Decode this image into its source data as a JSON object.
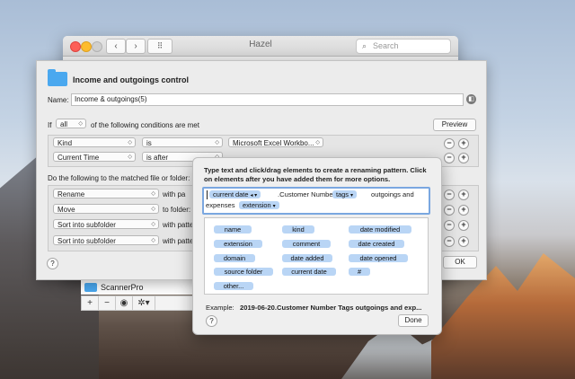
{
  "hazel": {
    "title": "Hazel",
    "search_placeholder": "Search",
    "back_glyph": "‹",
    "forward_glyph": "›",
    "grid_glyph": "⠿",
    "scanner_item": "ScannerPro",
    "bottom_buttons": [
      "+",
      "−",
      "◉",
      "✲▾"
    ]
  },
  "sheet": {
    "title": "Income and outgoings control",
    "name_label": "Name:",
    "name_value": "Income & outgoings(5)",
    "if_label": "If",
    "if_selector": "all",
    "if_rest": "of the following conditions are met",
    "preview_label": "Preview",
    "conditions": [
      {
        "attr": "Kind",
        "op": "is",
        "value": "Microsoft Excel Workbo..."
      },
      {
        "attr": "Current Time",
        "op": "is after",
        "value": ""
      }
    ],
    "do_label": "Do the following to the matched file or folder:",
    "actions": [
      {
        "action": "Rename",
        "with": "with pa"
      },
      {
        "action": "Move",
        "with": "to folder:"
      },
      {
        "action": "Sort into subfolder",
        "with": "with patte"
      },
      {
        "action": "Sort into subfolder",
        "with": "with patte"
      }
    ],
    "help": "?",
    "ok_label": "OK"
  },
  "popover": {
    "instructions": "Type text and click/drag elements to create a renaming pattern. Click on elements after you have added them for more options.",
    "pattern": {
      "token1": "current date",
      "text1": ".Customer Number",
      "token2": "tags",
      "text2": "outgoings and",
      "text3": "expenses",
      "token3": "extension"
    },
    "elements": [
      "name",
      "kind",
      "date modified",
      "extension",
      "comment",
      "date created",
      "domain",
      "date added",
      "date opened",
      "source folder",
      "current date",
      "#",
      "other..."
    ],
    "example_label": "Example:",
    "example_value": "2019-06-20.Customer Number Tags outgoings and exp...",
    "help": "?",
    "done_label": "Done"
  }
}
